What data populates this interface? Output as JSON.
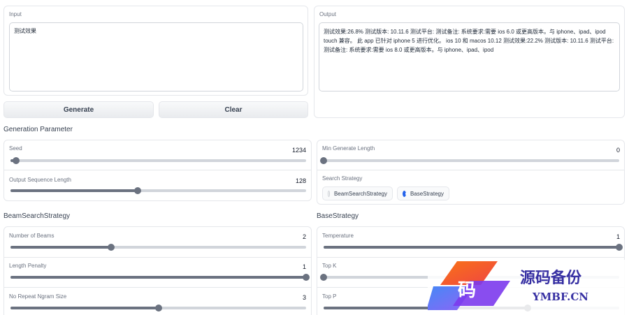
{
  "input": {
    "label": "Input",
    "value": "测试效果"
  },
  "output": {
    "label": "Output",
    "value": "测试效果:26.8% 测试版本: 10.11.6 测试平台: 测试备注: 系统要求:需要 ios 6.0 或更高版本。与 iphone、ipad、ipod touch 兼容。 此 app 已针对 iphone 5 进行优化。 ios 10 和 macos 10.12 测试效果:22.2% 测试版本: 10.11.6 测试平台: 测试备注: 系统要求:需要 ios 8.0 或更高版本。与 iphone、ipad、ipod"
  },
  "buttons": {
    "generate": "Generate",
    "clear": "Clear"
  },
  "generation": {
    "title": "Generation Parameter",
    "seed": {
      "label": "Seed",
      "value": "1234",
      "fraction": 0.02
    },
    "output_len": {
      "label": "Output Sequence Length",
      "value": "128",
      "fraction": 0.43
    },
    "min_len": {
      "label": "Min Generate Length",
      "value": "0",
      "fraction": 0.0
    },
    "search": {
      "label": "Search Strategy",
      "options": [
        "BeamSearchStrategy",
        "BaseStrategy"
      ],
      "selected": "BaseStrategy"
    }
  },
  "beam": {
    "title": "BeamSearchStrategy",
    "num_beams": {
      "label": "Number of Beams",
      "value": "2",
      "fraction": 0.34
    },
    "length_penalty": {
      "label": "Length Penalty",
      "value": "1",
      "fraction": 1.0
    },
    "no_repeat": {
      "label": "No Repeat Ngram Size",
      "value": "3",
      "fraction": 0.5
    }
  },
  "base": {
    "title": "BaseStrategy",
    "temperature": {
      "label": "Temperature",
      "value": "1",
      "fraction": 1.0
    },
    "top_k": {
      "label": "Top K",
      "value": "",
      "fraction": 0.0
    },
    "top_p": {
      "label": "Top P",
      "value": "",
      "fraction": 0.69
    }
  },
  "watermark": {
    "title": "源码备份",
    "subtitle": "YMBF.CN",
    "glyph": "码"
  }
}
